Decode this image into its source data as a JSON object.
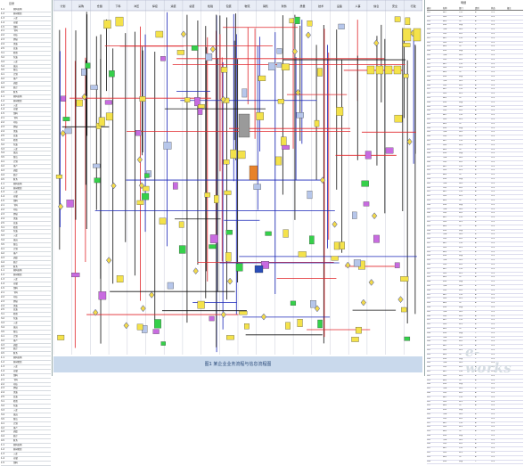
{
  "left_panel": {
    "title": "目录",
    "rows": [
      [
        "1-1",
        "原料采购"
      ],
      [
        "1-2",
        "原材检验"
      ],
      [
        "1-3",
        "入库"
      ],
      [
        "1-4",
        "仓储"
      ],
      [
        "1-5",
        "领料"
      ],
      [
        "2-1",
        "下料"
      ],
      [
        "2-2",
        "冲压"
      ],
      [
        "2-3",
        "焊接"
      ],
      [
        "2-4",
        "涂装"
      ],
      [
        "2-5",
        "总装"
      ],
      [
        "3-1",
        "检验"
      ],
      [
        "3-2",
        "包装"
      ],
      [
        "3-3",
        "入库"
      ],
      [
        "3-4",
        "发运"
      ],
      [
        "3-5",
        "售后"
      ],
      [
        "4-1",
        "计划"
      ],
      [
        "4-2",
        "排产"
      ],
      [
        "4-3",
        "调度"
      ],
      [
        "4-4",
        "统计"
      ],
      [
        "4-5",
        "财务"
      ]
    ]
  },
  "right_panel": {
    "title": "明细",
    "headers": [
      "编号",
      "名称",
      "部门",
      "类别",
      "状态",
      "备注"
    ],
    "rows": [
      [
        "001",
        "输入",
        "计划",
        "A",
        "正常",
        ""
      ],
      [
        "002",
        "审批",
        "技术",
        "B",
        "正常",
        ""
      ],
      [
        "003",
        "输出",
        "生产",
        "A",
        "正常",
        ""
      ],
      [
        "004",
        "检验",
        "质量",
        "C",
        "正常",
        ""
      ],
      [
        "005",
        "传递",
        "物流",
        "B",
        "正常",
        ""
      ],
      [
        "006",
        "存档",
        "财务",
        "A",
        "正常",
        ""
      ]
    ]
  },
  "flow": {
    "lane_titles": [
      "计划",
      "采购",
      "仓储",
      "下料",
      "冲压",
      "焊接",
      "涂装",
      "总装",
      "检验",
      "包装",
      "物流",
      "销售",
      "财务",
      "质量",
      "技术",
      "设备",
      "人事",
      "信息",
      "安全",
      "行政"
    ]
  },
  "footer": {
    "caption": "图1 某企业业务流程与信息流程图"
  },
  "watermark": {
    "text": "e-works"
  },
  "colors": {
    "lane_header": "#3c4f9c",
    "box_yellow": "#f4e24a",
    "box_green": "#35d04a",
    "box_gray": "#9a9a9a",
    "box_orange": "#e8822a",
    "line_red": "#e0262b",
    "line_blue": "#1a27b8",
    "line_black": "#111111",
    "footer_band": "#c9d9ec"
  }
}
